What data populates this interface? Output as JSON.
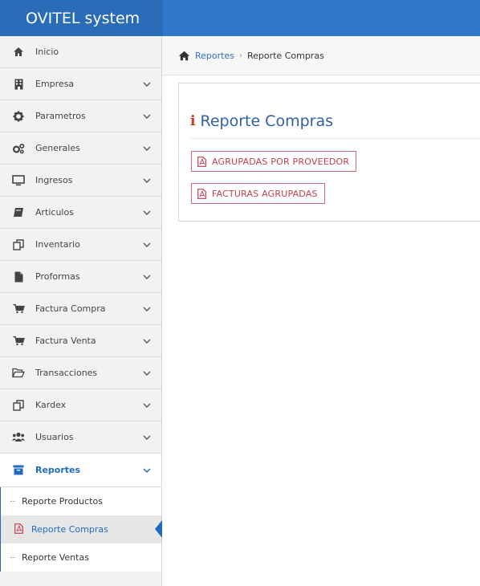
{
  "app": {
    "title": "OVITEL system"
  },
  "breadcrumb": {
    "home": "Reportes",
    "current": "Reporte Compras"
  },
  "sidebar": {
    "items": [
      {
        "label": "Inicio",
        "icon": "home-icon",
        "has_chevron": false
      },
      {
        "label": "Empresa",
        "icon": "building-icon",
        "has_chevron": true
      },
      {
        "label": "Parametros",
        "icon": "gear-icon",
        "has_chevron": true
      },
      {
        "label": "Generales",
        "icon": "gears-icon",
        "has_chevron": true
      },
      {
        "label": "Ingresos",
        "icon": "monitor-icon",
        "has_chevron": true
      },
      {
        "label": "Articulos",
        "icon": "book-icon",
        "has_chevron": true
      },
      {
        "label": "Inventario",
        "icon": "copy-icon",
        "has_chevron": true
      },
      {
        "label": "Proformas",
        "icon": "file-icon",
        "has_chevron": true
      },
      {
        "label": "Factura Compra",
        "icon": "cart-icon",
        "has_chevron": true
      },
      {
        "label": "Factura Venta",
        "icon": "cart-icon",
        "has_chevron": true
      },
      {
        "label": "Transacciones",
        "icon": "folder-open-icon",
        "has_chevron": true
      },
      {
        "label": "Kardex",
        "icon": "copy-icon",
        "has_chevron": true
      },
      {
        "label": "Usuarios",
        "icon": "users-icon",
        "has_chevron": true
      },
      {
        "label": "Reportes",
        "icon": "archive-icon",
        "has_chevron": true,
        "active": true
      }
    ],
    "submenu": [
      {
        "label": "Reporte Productos"
      },
      {
        "label": "Reporte Compras",
        "current": true
      },
      {
        "label": "Reporte Ventas"
      }
    ]
  },
  "panel": {
    "title": "Reporte Compras",
    "buttons": [
      {
        "label": "AGRUPADAS POR PROVEEDOR"
      },
      {
        "label": "FACTURAS AGRUPADAS"
      }
    ]
  },
  "colors": {
    "topbar": "#2f77c8",
    "accent": "#1f6bc0",
    "button_border": "#d36a7a",
    "button_text": "#c23c52",
    "info_icon": "#c8381b"
  }
}
